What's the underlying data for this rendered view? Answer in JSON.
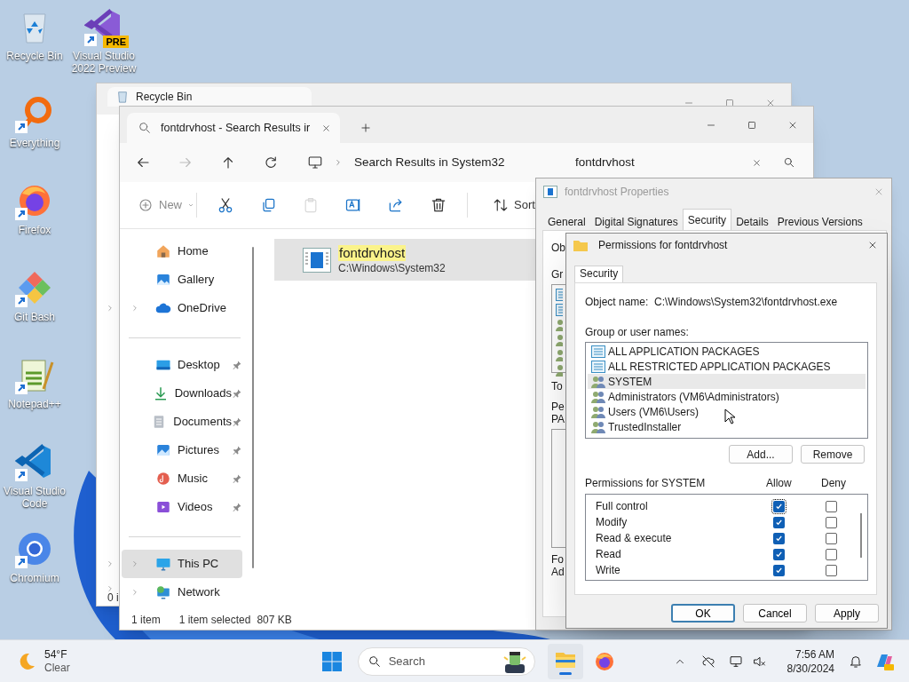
{
  "desktop_icons": [
    {
      "label": "Recycle Bin",
      "kind": "recycle",
      "shortcut": false
    },
    {
      "label": "Everything",
      "kind": "everything",
      "shortcut": true
    },
    {
      "label": "Firefox",
      "kind": "firefox",
      "shortcut": true
    },
    {
      "label": "Git Bash",
      "kind": "gitbash",
      "shortcut": true
    },
    {
      "label": "Notepad++",
      "kind": "notepad",
      "shortcut": true
    },
    {
      "label": "Visual Studio Code",
      "kind": "vscode",
      "shortcut": true
    },
    {
      "label": "Chromium",
      "kind": "chromium",
      "shortcut": true
    },
    {
      "label": "Visual Studio 2022 Preview",
      "kind": "vs",
      "shortcut": true,
      "badge": "PRE"
    }
  ],
  "back_window": {
    "tab_title": "Recycle Bin",
    "status_text": "0 i"
  },
  "explorer": {
    "tab_title": "fontdrvhost - Search Results ir",
    "nav": [
      {
        "kind": "back",
        "disabled": false
      },
      {
        "kind": "forward",
        "disabled": true
      },
      {
        "kind": "up",
        "disabled": false
      },
      {
        "kind": "refresh",
        "disabled": false
      }
    ],
    "breadcrumb": "Search Results in System32",
    "search_value": "fontdrvhost",
    "toolbar": [
      {
        "kind": "new",
        "label": "New",
        "disabled": true
      },
      {
        "kind": "cut",
        "disabled": false
      },
      {
        "kind": "copy",
        "disabled": false
      },
      {
        "kind": "paste",
        "disabled": true
      },
      {
        "kind": "rename",
        "disabled": false
      },
      {
        "kind": "share",
        "disabled": false
      },
      {
        "kind": "delete",
        "disabled": false
      },
      {
        "kind": "sort",
        "label": "Sort",
        "disabled": false
      }
    ],
    "sidebar_sections": [
      {
        "items": [
          {
            "label": "Home",
            "kind": "home",
            "expandable": false,
            "pinned": false,
            "selected": false
          },
          {
            "label": "Gallery",
            "kind": "gallery",
            "expandable": false,
            "pinned": false,
            "selected": false
          },
          {
            "label": "OneDrive",
            "kind": "cloud",
            "expandable": true,
            "pinned": false,
            "selected": false
          }
        ]
      },
      {
        "items": [
          {
            "label": "Desktop",
            "kind": "desktop",
            "expandable": false,
            "pinned": true,
            "selected": false
          },
          {
            "label": "Downloads",
            "kind": "downloads",
            "expandable": false,
            "pinned": true,
            "selected": false
          },
          {
            "label": "Documents",
            "kind": "documents",
            "expandable": false,
            "pinned": true,
            "selected": false
          },
          {
            "label": "Pictures",
            "kind": "pictures",
            "expandable": false,
            "pinned": true,
            "selected": false
          },
          {
            "label": "Music",
            "kind": "music",
            "expandable": false,
            "pinned": true,
            "selected": false
          },
          {
            "label": "Videos",
            "kind": "videos",
            "expandable": false,
            "pinned": true,
            "selected": false
          }
        ]
      },
      {
        "items": [
          {
            "label": "This PC",
            "kind": "pc",
            "expandable": true,
            "pinned": false,
            "selected": true
          },
          {
            "label": "Network",
            "kind": "network",
            "expandable": true,
            "pinned": false,
            "selected": false
          }
        ]
      }
    ],
    "results": [
      {
        "name": "fontdrvhost",
        "path": "C:\\Windows\\System32",
        "selected": true
      }
    ],
    "status": [
      "1 item",
      "1 item selected",
      "807 KB"
    ]
  },
  "properties": {
    "title": "fontdrvhost Properties",
    "tabs": [
      {
        "label": "General",
        "selected": false
      },
      {
        "label": "Digital Signatures",
        "selected": false
      },
      {
        "label": "Security",
        "selected": true
      },
      {
        "label": "Details",
        "selected": false
      },
      {
        "label": "Previous Versions",
        "selected": false
      }
    ],
    "cut_labels": [
      "Ob",
      "Gr",
      "To",
      "Pe",
      "PA",
      "Fo",
      "Ad"
    ]
  },
  "permissions": {
    "title": "Permissions for fontdrvhost",
    "tab": "Security",
    "object_label": "Object name:",
    "object_value": "C:\\Windows\\System32\\fontdrvhost.exe",
    "group_label": "Group or user names:",
    "principals": [
      {
        "name": "ALL APPLICATION PACKAGES",
        "kind": "package",
        "selected": false
      },
      {
        "name": "ALL RESTRICTED APPLICATION PACKAGES",
        "kind": "package",
        "selected": false
      },
      {
        "name": "SYSTEM",
        "kind": "group",
        "selected": true
      },
      {
        "name": "Administrators (VM6\\Administrators)",
        "kind": "group",
        "selected": false
      },
      {
        "name": "Users (VM6\\Users)",
        "kind": "group",
        "selected": false
      },
      {
        "name": "TrustedInstaller",
        "kind": "group",
        "selected": false
      }
    ],
    "list_buttons": [
      "Add...",
      "Remove"
    ],
    "perm_label": "Permissions for SYSTEM",
    "allow_label": "Allow",
    "deny_label": "Deny",
    "perms": [
      {
        "name": "Full control",
        "allow": true,
        "deny": false
      },
      {
        "name": "Modify",
        "allow": true,
        "deny": false
      },
      {
        "name": "Read & execute",
        "allow": true,
        "deny": false
      },
      {
        "name": "Read",
        "allow": true,
        "deny": false
      },
      {
        "name": "Write",
        "allow": true,
        "deny": false
      }
    ],
    "buttons": [
      "OK",
      "Cancel",
      "Apply"
    ]
  },
  "taskbar": {
    "weather": {
      "temp": "54°F",
      "condition": "Clear"
    },
    "search_placeholder": "Search",
    "apps": [
      {
        "kind": "explorer",
        "active": true
      },
      {
        "kind": "firefox",
        "active": false
      }
    ],
    "time": "7:56 AM",
    "date": "8/30/2024"
  }
}
